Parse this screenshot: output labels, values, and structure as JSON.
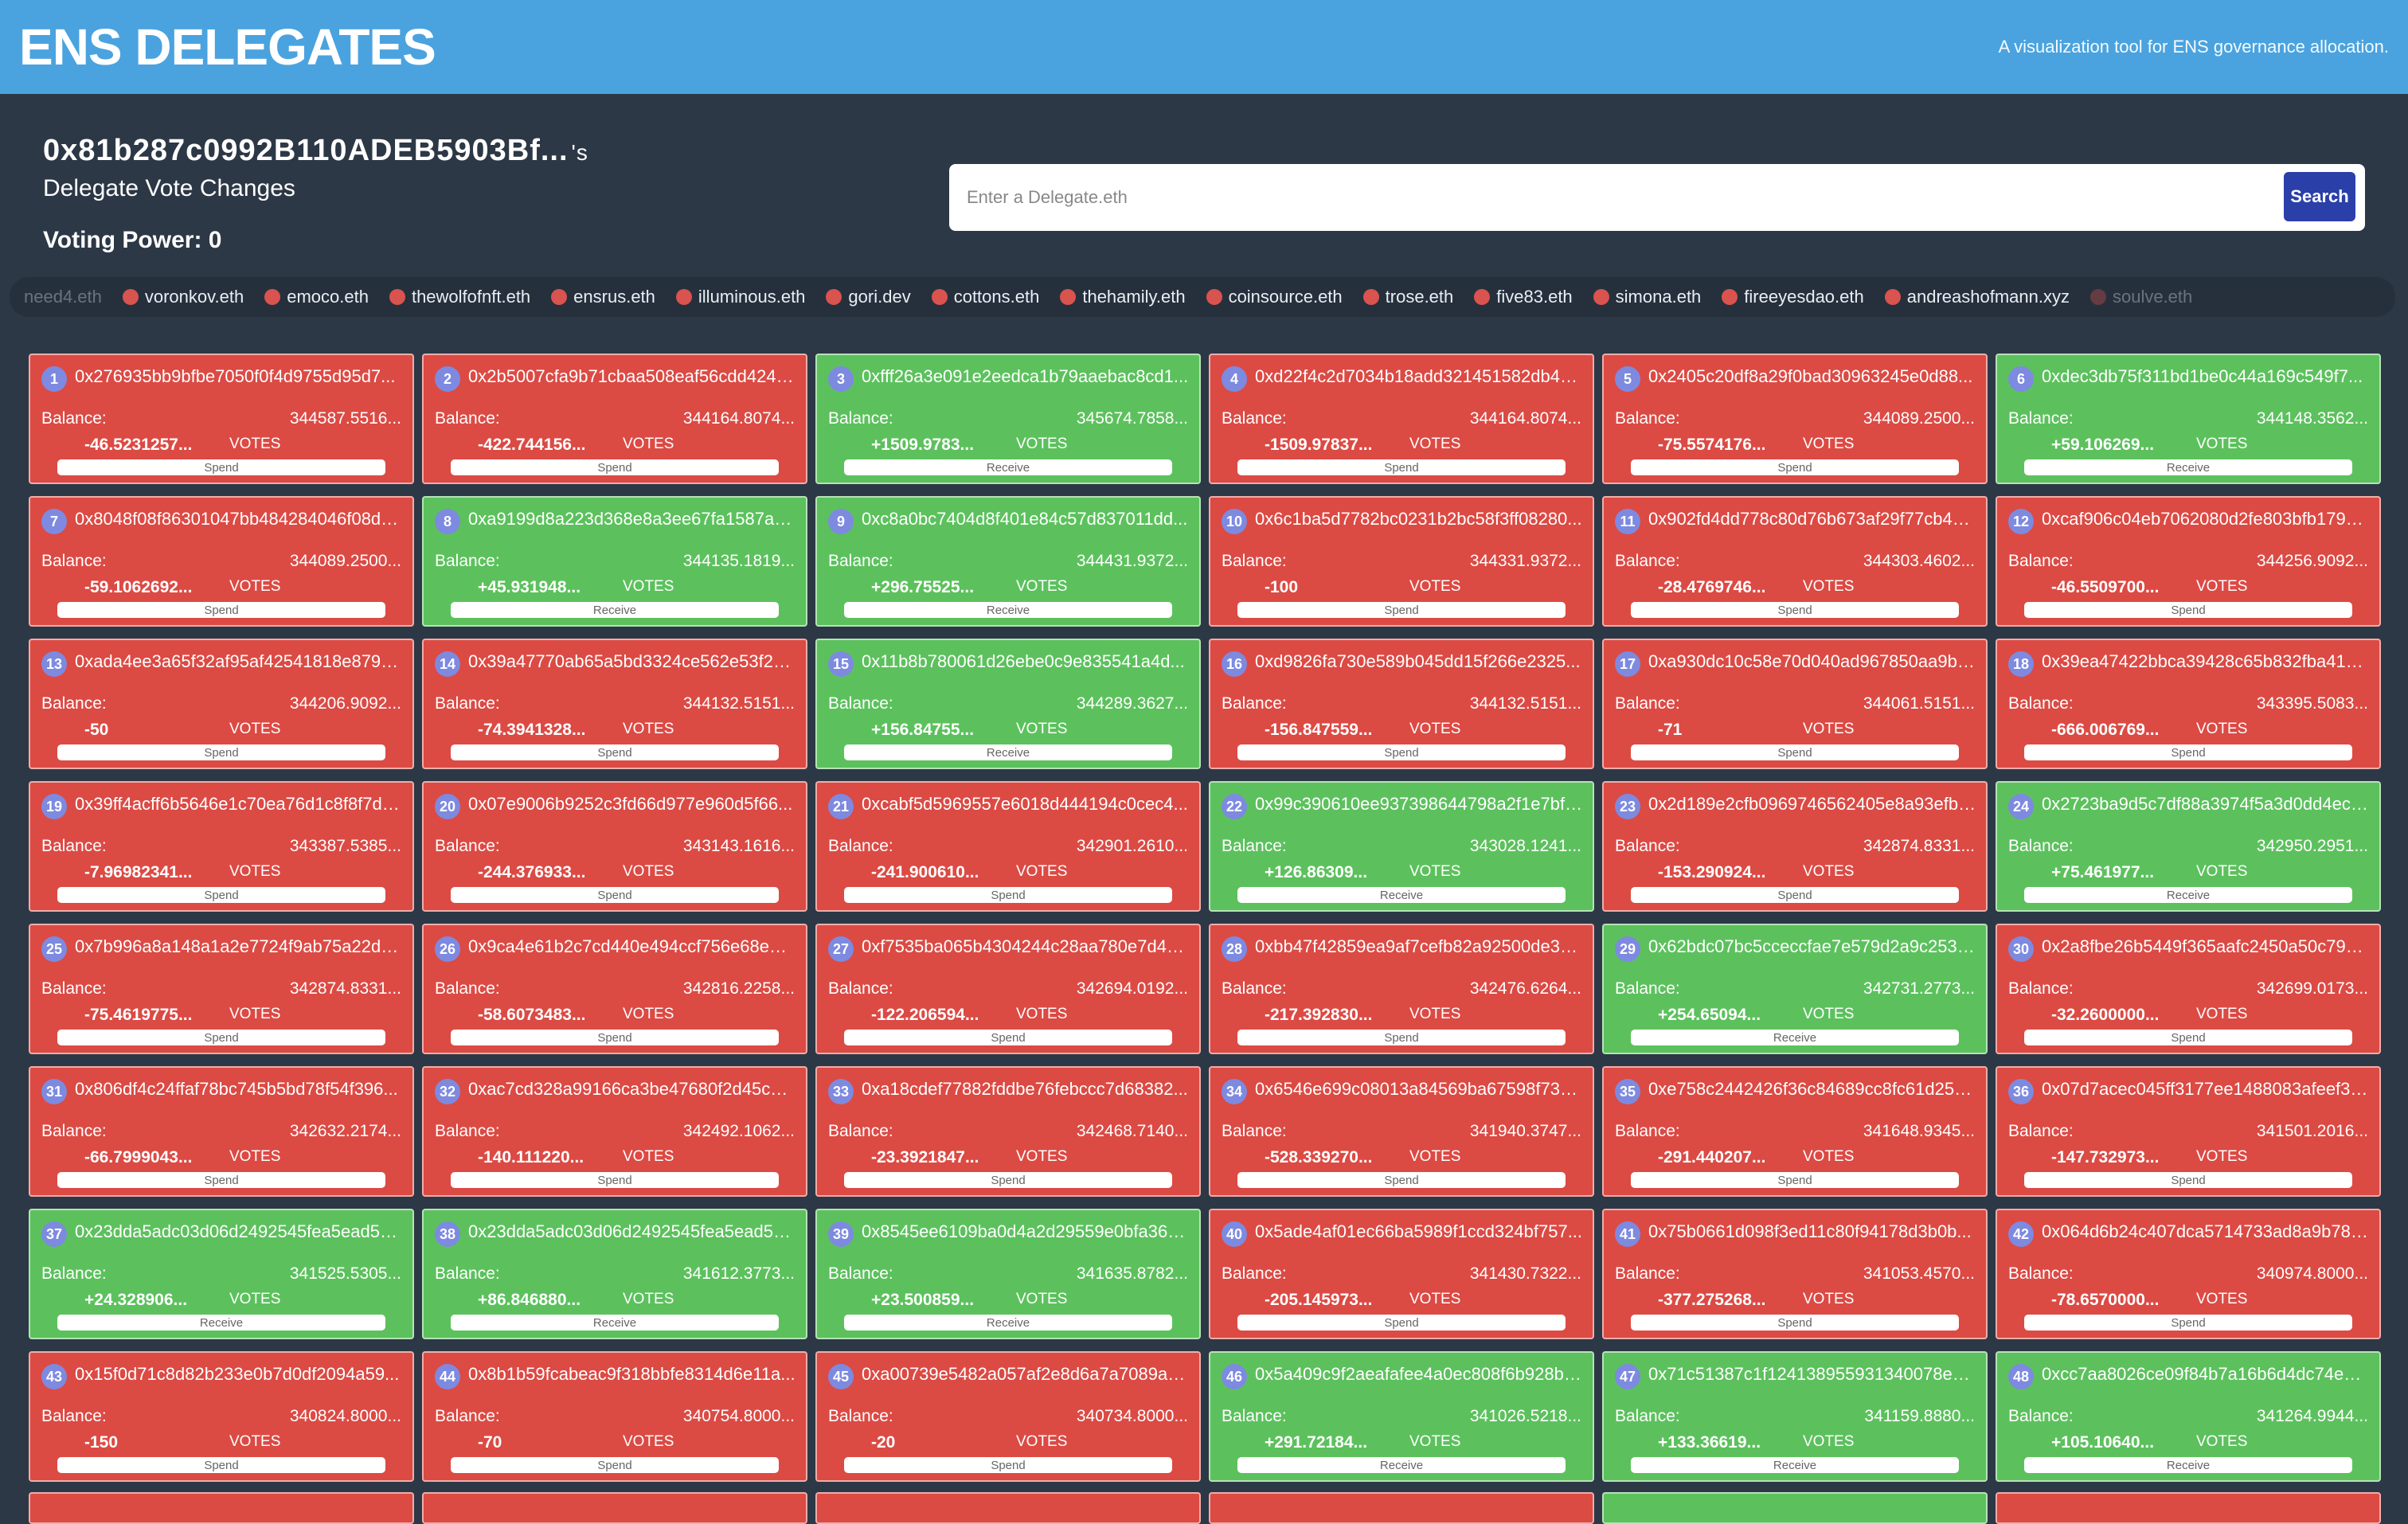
{
  "app": {
    "title": "ENS DELEGATES",
    "tagline": "A visualization tool for ENS governance allocation."
  },
  "profile": {
    "address": "0x81b287c0992B110ADEB5903Bf...",
    "suffix": "'s",
    "subtitle": "Delegate Vote Changes",
    "voting_power": "Voting Power: 0"
  },
  "search": {
    "placeholder": "Enter a Delegate.eth",
    "button": "Search"
  },
  "ticker": [
    "need4.eth",
    "voronkov.eth",
    "emoco.eth",
    "thewolfofnft.eth",
    "ensrus.eth",
    "illuminous.eth",
    "gori.dev",
    "cottons.eth",
    "thehamily.eth",
    "coinsource.eth",
    "trose.eth",
    "five83.eth",
    "simona.eth",
    "fireeyesdao.eth",
    "andreashofmann.xyz",
    "soulve.eth"
  ],
  "labels": {
    "balance": "Balance:",
    "votes": "VOTES",
    "spend": "Spend",
    "receive": "Receive"
  },
  "colors": {
    "header": "#4aa3df",
    "background": "#2d3846",
    "spend": "#dc4a44",
    "receive": "#5cc15d",
    "rank_badge": "#7d8ae0",
    "search_button": "#2b3fa8"
  },
  "cards": [
    {
      "rank": "1",
      "address": "0x276935bb9bfbe7050f0f4d9755d95d7...",
      "balance": "344587.5516...",
      "change": "-46.5231257...",
      "type": "spend"
    },
    {
      "rank": "2",
      "address": "0x2b5007cfa9b71cbaa508eaf56cdd424b...",
      "balance": "344164.8074...",
      "change": "-422.744156...",
      "type": "spend"
    },
    {
      "rank": "3",
      "address": "0xfff26a3e091e2eedca1b79aaebac8cd1...",
      "balance": "345674.7858...",
      "change": "+1509.9783...",
      "type": "receive"
    },
    {
      "rank": "4",
      "address": "0xd22f4c2d7034b18add321451582db49...",
      "balance": "344164.8074...",
      "change": "-1509.97837...",
      "type": "spend"
    },
    {
      "rank": "5",
      "address": "0x2405c20df8a29f0bad30963245e0d88...",
      "balance": "344089.2500...",
      "change": "-75.5574176...",
      "type": "spend"
    },
    {
      "rank": "6",
      "address": "0xdec3db75f311bd1be0c44a169c549f7...",
      "balance": "344148.3562...",
      "change": "+59.106269...",
      "type": "receive"
    },
    {
      "rank": "7",
      "address": "0x8048f08f86301047bb484284046f08d0...",
      "balance": "344089.2500...",
      "change": "-59.1062692...",
      "type": "spend"
    },
    {
      "rank": "8",
      "address": "0xa9199d8a223d368e8a3ee67fa1587a0...",
      "balance": "344135.1819...",
      "change": "+45.931948...",
      "type": "receive"
    },
    {
      "rank": "9",
      "address": "0xc8a0bc7404d8f401e84c57d837011dd...",
      "balance": "344431.9372...",
      "change": "+296.75525...",
      "type": "receive"
    },
    {
      "rank": "10",
      "address": "0x6c1ba5d7782bc0231b2bc58f3ff08280...",
      "balance": "344331.9372...",
      "change": "-100",
      "type": "spend"
    },
    {
      "rank": "11",
      "address": "0x902fd4dd778c80d76b673af29f77cb40...",
      "balance": "344303.4602...",
      "change": "-28.4769746...",
      "type": "spend"
    },
    {
      "rank": "12",
      "address": "0xcaf906c04eb7062080d2fe803bfb1791...",
      "balance": "344256.9092...",
      "change": "-46.5509700...",
      "type": "spend"
    },
    {
      "rank": "13",
      "address": "0xada4ee3a65f32af95af42541818e8798...",
      "balance": "344206.9092...",
      "change": "-50",
      "type": "spend"
    },
    {
      "rank": "14",
      "address": "0x39a47770ab65a5bd3324ce562e53f27...",
      "balance": "344132.5151...",
      "change": "-74.3941328...",
      "type": "spend"
    },
    {
      "rank": "15",
      "address": "0x11b8b780061d26ebe0c9e835541a4d...",
      "balance": "344289.3627...",
      "change": "+156.84755...",
      "type": "receive"
    },
    {
      "rank": "16",
      "address": "0xd9826fa730e589b045dd15f266e2325...",
      "balance": "344132.5151...",
      "change": "-156.847559...",
      "type": "spend"
    },
    {
      "rank": "17",
      "address": "0xa930dc10c58e70d040ad967850aa9bf...",
      "balance": "344061.5151...",
      "change": "-71",
      "type": "spend"
    },
    {
      "rank": "18",
      "address": "0x39ea47422bbca39428c65b832fba415...",
      "balance": "343395.5083...",
      "change": "-666.006769...",
      "type": "spend"
    },
    {
      "rank": "19",
      "address": "0x39ff4acff6b5646e1c70ea76d1c8f8f7db...",
      "balance": "343387.5385...",
      "change": "-7.96982341...",
      "type": "spend"
    },
    {
      "rank": "20",
      "address": "0x07e9006b9252c3fd66d977e960d5f66...",
      "balance": "343143.1616...",
      "change": "-244.376933...",
      "type": "spend"
    },
    {
      "rank": "21",
      "address": "0xcabf5d5969557e6018d444194c0cec4...",
      "balance": "342901.2610...",
      "change": "-241.900610...",
      "type": "spend"
    },
    {
      "rank": "22",
      "address": "0x99c390610ee937398644798a2f1e7bfc...",
      "balance": "343028.1241...",
      "change": "+126.86309...",
      "type": "receive"
    },
    {
      "rank": "23",
      "address": "0x2d189e2cfb0969746562405e8a93efb2...",
      "balance": "342874.8331...",
      "change": "-153.290924...",
      "type": "spend"
    },
    {
      "rank": "24",
      "address": "0x2723ba9d5c7df88a3974f5a3d0dd4ecf...",
      "balance": "342950.2951...",
      "change": "+75.461977...",
      "type": "receive"
    },
    {
      "rank": "25",
      "address": "0x7b996a8a148a1a2e7724f9ab75a22db...",
      "balance": "342874.8331...",
      "change": "-75.4619775...",
      "type": "spend"
    },
    {
      "rank": "26",
      "address": "0x9ca4e61b2c7cd440e494ccf756e68e05...",
      "balance": "342816.2258...",
      "change": "-58.6073483...",
      "type": "spend"
    },
    {
      "rank": "27",
      "address": "0xf7535ba065b4304244c28aa780e7d4d...",
      "balance": "342694.0192...",
      "change": "-122.206594...",
      "type": "spend"
    },
    {
      "rank": "28",
      "address": "0xbb47f42859ea9af7cefb82a92500de3e...",
      "balance": "342476.6264...",
      "change": "-217.392830...",
      "type": "spend"
    },
    {
      "rank": "29",
      "address": "0x62bdc07bc5cceccfae7e579d2a9c253b...",
      "balance": "342731.2773...",
      "change": "+254.65094...",
      "type": "receive"
    },
    {
      "rank": "30",
      "address": "0x2a8fbe26b5449f365aafc2450a50c794...",
      "balance": "342699.0173...",
      "change": "-32.2600000...",
      "type": "spend"
    },
    {
      "rank": "31",
      "address": "0x806df4c24ffaf78bc745b5bd78f54f396...",
      "balance": "342632.2174...",
      "change": "-66.7999043...",
      "type": "spend"
    },
    {
      "rank": "32",
      "address": "0xac7cd328a99166ca3be47680f2d45cac...",
      "balance": "342492.1062...",
      "change": "-140.111220...",
      "type": "spend"
    },
    {
      "rank": "33",
      "address": "0xa18cdef77882fddbe76febccc7d68382...",
      "balance": "342468.7140...",
      "change": "-23.3921847...",
      "type": "spend"
    },
    {
      "rank": "34",
      "address": "0x6546e699c08013a84569ba67598f73d...",
      "balance": "341940.3747...",
      "change": "-528.339270...",
      "type": "spend"
    },
    {
      "rank": "35",
      "address": "0xe758c2442426f36c84689cc8fc61d25c...",
      "balance": "341648.9345...",
      "change": "-291.440207...",
      "type": "spend"
    },
    {
      "rank": "36",
      "address": "0x07d7acec045ff3177ee1488083afeef3b...",
      "balance": "341501.2016...",
      "change": "-147.732973...",
      "type": "spend"
    },
    {
      "rank": "37",
      "address": "0x23dda5adc03d06d2492545fea5ead5a...",
      "balance": "341525.5305...",
      "change": "+24.328906...",
      "type": "receive"
    },
    {
      "rank": "38",
      "address": "0x23dda5adc03d06d2492545fea5ead5a...",
      "balance": "341612.3773...",
      "change": "+86.846880...",
      "type": "receive"
    },
    {
      "rank": "39",
      "address": "0x8545ee6109ba0d4a2d29559e0bfa368...",
      "balance": "341635.8782...",
      "change": "+23.500859...",
      "type": "receive"
    },
    {
      "rank": "40",
      "address": "0x5ade4af01ec66ba5989f1ccd324bf757...",
      "balance": "341430.7322...",
      "change": "-205.145973...",
      "type": "spend"
    },
    {
      "rank": "41",
      "address": "0x75b0661d098f3ed11c80f94178d3b0b...",
      "balance": "341053.4570...",
      "change": "-377.275268...",
      "type": "spend"
    },
    {
      "rank": "42",
      "address": "0x064d6b24c407dca5714733ad8a9b78f...",
      "balance": "340974.8000...",
      "change": "-78.6570000...",
      "type": "spend"
    },
    {
      "rank": "43",
      "address": "0x15f0d71c8d82b233e0b7d0df2094a59...",
      "balance": "340824.8000...",
      "change": "-150",
      "type": "spend"
    },
    {
      "rank": "44",
      "address": "0x8b1b59fcabeac9f318bbfe8314d6e11a...",
      "balance": "340754.8000...",
      "change": "-70",
      "type": "spend"
    },
    {
      "rank": "45",
      "address": "0xa00739e5482a057af2e8d6a7a7089aa6...",
      "balance": "340734.8000...",
      "change": "-20",
      "type": "spend"
    },
    {
      "rank": "46",
      "address": "0x5a409c9f2aeafafee4a0ec808f6b928bb...",
      "balance": "341026.5218...",
      "change": "+291.72184...",
      "type": "receive"
    },
    {
      "rank": "47",
      "address": "0x71c51387c1f124138955931340078e7...",
      "balance": "341159.8880...",
      "change": "+133.36619...",
      "type": "receive"
    },
    {
      "rank": "48",
      "address": "0xcc7aa8026ce09f84b7a16b6d4dc74e0f...",
      "balance": "341264.9944...",
      "change": "+105.10640...",
      "type": "receive"
    }
  ],
  "next_row_types": [
    "spend",
    "spend",
    "spend",
    "spend",
    "receive",
    "spend"
  ]
}
